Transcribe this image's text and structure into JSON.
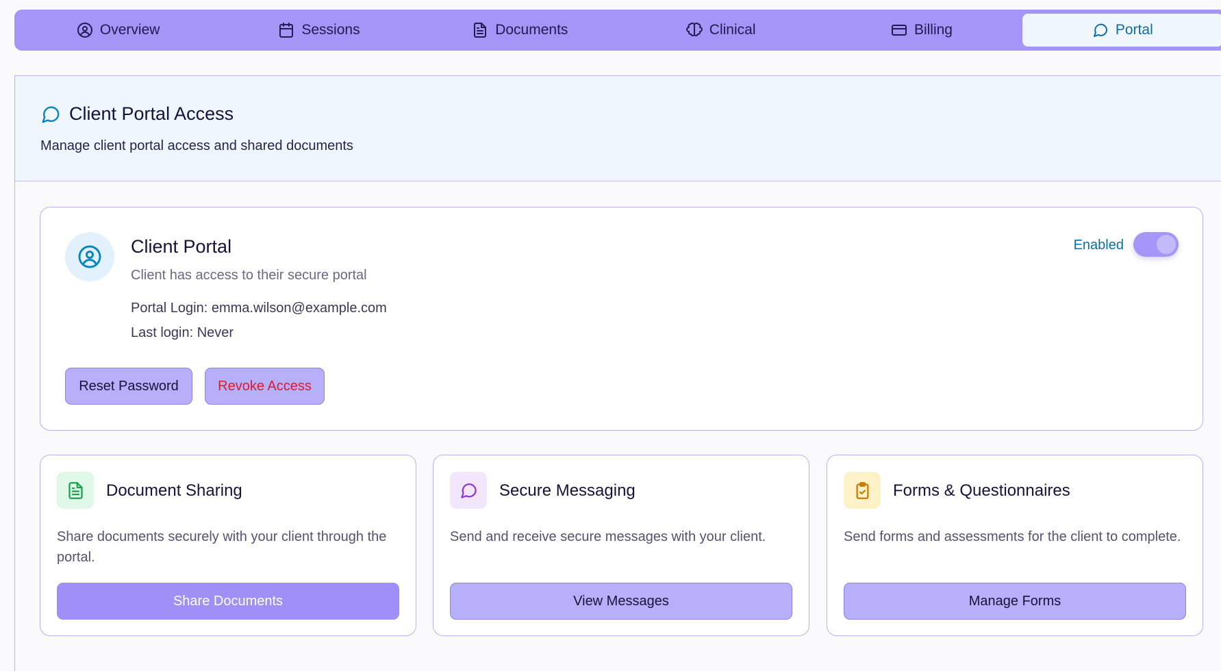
{
  "tabs": [
    {
      "label": "Overview",
      "icon": "user-circle-icon",
      "active": false
    },
    {
      "label": "Sessions",
      "icon": "calendar-icon",
      "active": false
    },
    {
      "label": "Documents",
      "icon": "document-icon",
      "active": false
    },
    {
      "label": "Clinical",
      "icon": "brain-icon",
      "active": false
    },
    {
      "label": "Billing",
      "icon": "credit-card-icon",
      "active": false
    },
    {
      "label": "Portal",
      "icon": "message-circle-icon",
      "active": true
    }
  ],
  "header": {
    "title": "Client Portal Access",
    "subtitle": "Manage client portal access and shared documents",
    "icon": "message-circle-icon"
  },
  "portal": {
    "title": "Client Portal",
    "subtitle": "Client has access to their secure portal",
    "login": "Portal Login: emma.wilson@example.com",
    "last_login": "Last login: Never",
    "status_label": "Enabled",
    "enabled": true,
    "reset_label": "Reset Password",
    "revoke_label": "Revoke Access",
    "icon": "user-circle-icon"
  },
  "features": [
    {
      "title": "Document Sharing",
      "description": "Share documents securely with your client through the portal.",
      "button": "Share Documents",
      "icon": "file-text-icon",
      "color": "#1f9e50"
    },
    {
      "title": "Secure Messaging",
      "description": "Send and receive secure messages with your client.",
      "button": "View Messages",
      "icon": "message-circle-icon",
      "color": "#9236d6"
    },
    {
      "title": "Forms & Questionnaires",
      "description": "Send forms and assessments for the client to complete.",
      "button": "Manage Forms",
      "icon": "clipboard-check-icon",
      "color": "#c87a06"
    }
  ],
  "colors": {
    "accent": "#a495f6",
    "active_tab_text": "#0b6fa3",
    "danger": "#e0172d"
  }
}
